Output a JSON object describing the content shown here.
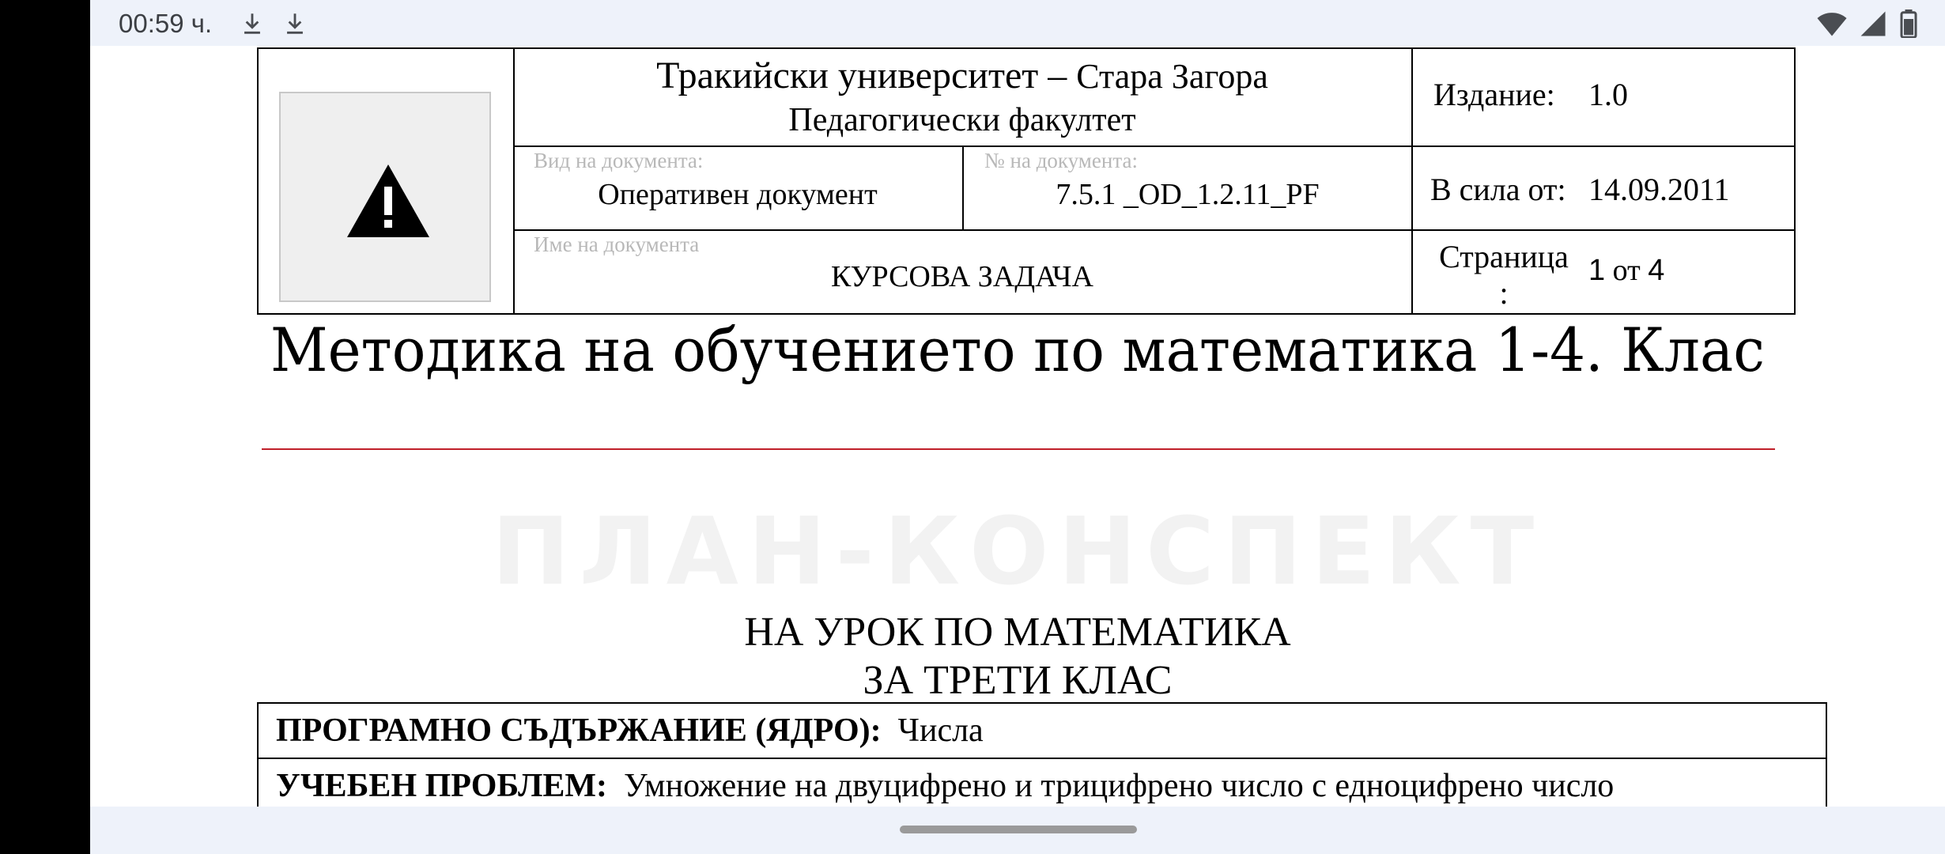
{
  "status_bar": {
    "time": "00:59 ч.",
    "icons": [
      "download-icon",
      "download-icon",
      "wifi-icon",
      "signal-icon",
      "battery-icon"
    ]
  },
  "header": {
    "university": "Тракийски университет",
    "dash": "–",
    "city": "Стара Загора",
    "faculty": "Педагогически факултет",
    "edition_label": "Издание:",
    "edition_value": "1.0",
    "doc_type_caption": "Вид на документа:",
    "doc_type_value": "Оперативен документ",
    "doc_num_caption": "№ на документа:",
    "doc_num_value": "7.5.1 _OD_1.2.11_PF",
    "valid_label": "В сила от:",
    "valid_value": "14.09.2011",
    "doc_name_caption": "Име на документа",
    "doc_name_value": "КУРСОВА ЗАДАЧА",
    "page_label": "Страница",
    "page_colon": ":",
    "page_current": "1",
    "page_of": "от",
    "page_total": "4"
  },
  "title": "Методика на обучението по математика 1-4. Клас",
  "watermark": "ПЛАН-КОНСПЕКТ",
  "lesson": {
    "line1": "НА УРОК ПО МАТЕМАТИКА",
    "line2": "ЗА ТРЕТИ КЛАС"
  },
  "info_rows": [
    {
      "label": "ПРОГРАМНО СЪДЪРЖАНИЕ (ЯДРО):",
      "value": "Числа"
    },
    {
      "label": "УЧЕБЕН ПРОБЛЕМ:",
      "value": "Умножение на двуцифрено и трицифрено число с едноцифрено число"
    }
  ],
  "colors": {
    "status_bg": "#eef2fa",
    "rule": "#c0202a",
    "watermark": "#f2f2f2"
  }
}
